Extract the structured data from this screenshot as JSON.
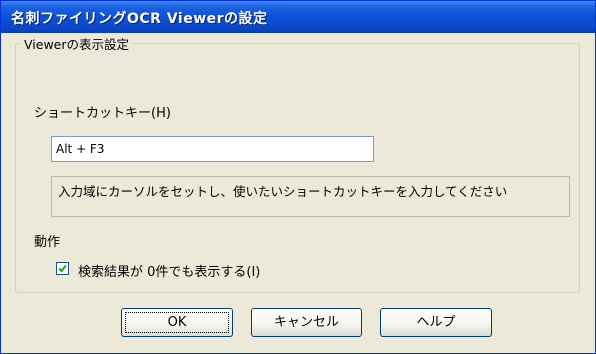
{
  "window": {
    "title": "名刺ファイリングOCR Viewerの設定"
  },
  "group": {
    "legend": "Viewerの表示設定"
  },
  "shortcut": {
    "label": "ショートカットキー(H)",
    "value": "Alt + F3",
    "hint": "入力域にカーソルをセットし、使いたいショートカットキーを入力してください"
  },
  "action": {
    "label": "動作",
    "checkbox_label": "検索結果が 0件でも表示する(I)",
    "checked": true
  },
  "buttons": {
    "ok": "OK",
    "cancel": "キャンセル",
    "help": "ヘルプ"
  },
  "colors": {
    "titlebar": "#0a48cc",
    "dialog_bg": "#ece9d8",
    "button_border": "#003c74",
    "check": "#21a121"
  }
}
